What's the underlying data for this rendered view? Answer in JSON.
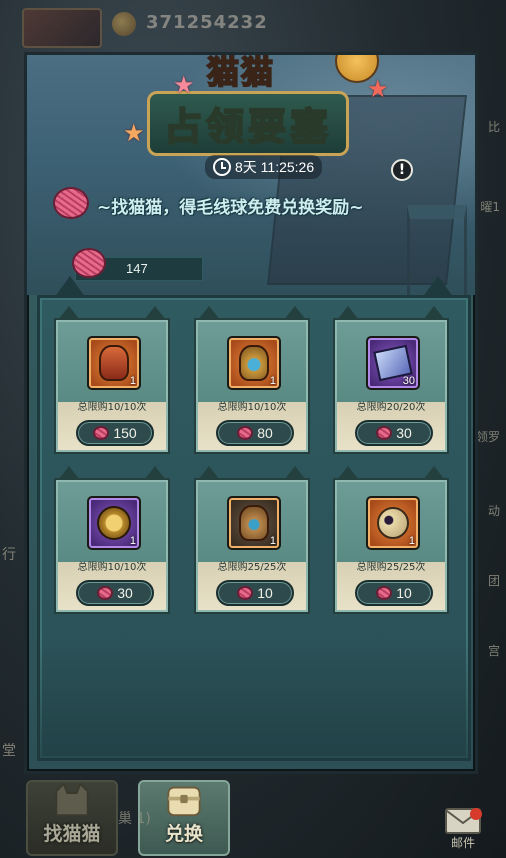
{
  "background": {
    "currency_value": "371254232",
    "right_side_labels": [
      "比",
      "曜1",
      "领罗",
      "动",
      "团",
      "宫"
    ],
    "left_side_labels": [
      "行",
      "堂"
    ],
    "behind_tab_text": "巢          1)"
  },
  "panel": {
    "title_line1": "猫猫",
    "title_line2": "占领要塞",
    "timer": "8天 11:25:26",
    "info_icon": "!",
    "tagline": "~找猫猫，得毛线球免费兑换奖励~",
    "balance": "147"
  },
  "shop": {
    "items": [
      {
        "name": "orange-vase",
        "rarity": "orange",
        "count": "1",
        "limit": "总限购10/10次",
        "price": "150"
      },
      {
        "name": "gold-blue-vase",
        "rarity": "orange",
        "count": "1",
        "limit": "总限购10/10次",
        "price": "80"
      },
      {
        "name": "blue-scroll",
        "rarity": "purple",
        "count": "30",
        "limit": "总限购20/20次",
        "price": "30"
      },
      {
        "name": "golden-trinket",
        "rarity": "purple",
        "count": "1",
        "limit": "总限购10/10次",
        "price": "30"
      },
      {
        "name": "bronze-vase",
        "rarity": "orange",
        "count": "1",
        "limit": "总限购25/25次",
        "price": "10"
      },
      {
        "name": "skull-potion",
        "rarity": "orange",
        "count": "1",
        "limit": "总限购25/25次",
        "price": "10"
      }
    ]
  },
  "tabs": {
    "find_cat": "找猫猫",
    "exchange": "兑换"
  },
  "mail": {
    "label": "邮件"
  },
  "colors": {
    "panel_teal": "#345a5e",
    "title_gold": "#f5c144",
    "yarn_pink": "#e86a8a",
    "rarity_orange": "#e88a3a",
    "rarity_purple": "#8a5ac8"
  }
}
